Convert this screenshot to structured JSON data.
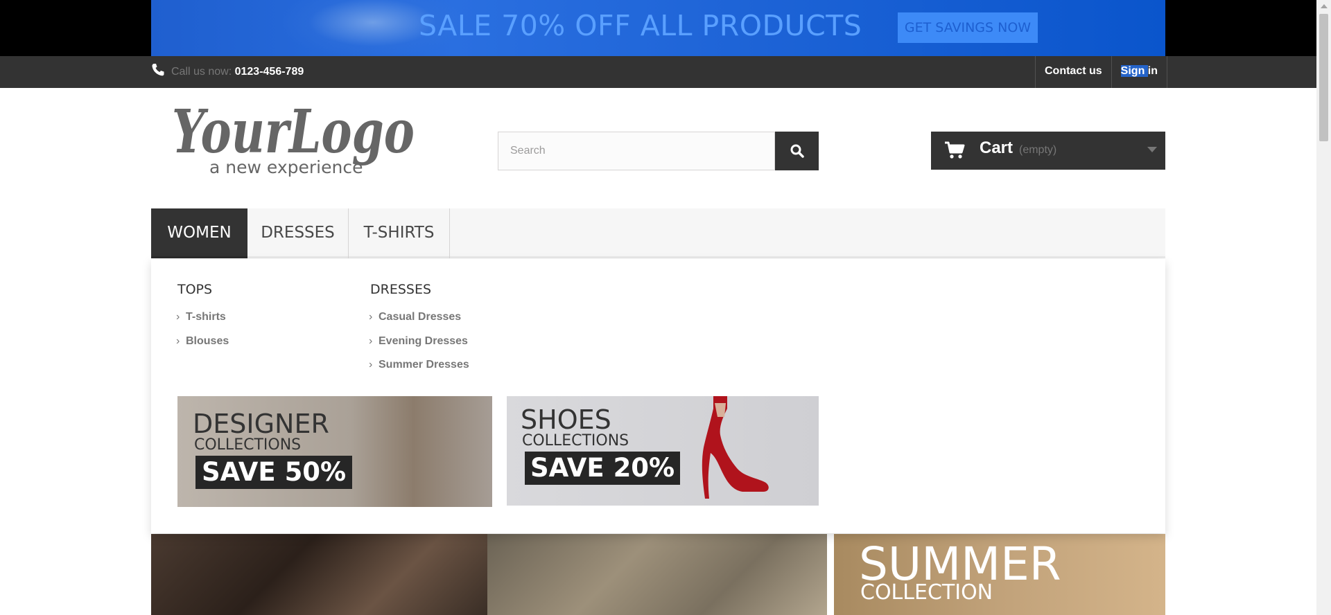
{
  "banner": {
    "text": "SALE 70% OFF ALL PRODUCTS",
    "cta": "GET SAVINGS NOW"
  },
  "topbar": {
    "call_label": "Call us now:",
    "phone": "0123-456-789",
    "contact": "Contact us",
    "signin_highlight": "Sign ",
    "signin_rest": "in"
  },
  "header": {
    "logo_text": "YourLogo",
    "logo_tagline": "a new experience",
    "search_placeholder": "Search",
    "cart_label": "Cart",
    "cart_status": "(empty)"
  },
  "menu": {
    "items": [
      {
        "label": "WOMEN",
        "active": true
      },
      {
        "label": "DRESSES",
        "active": false
      },
      {
        "label": "T-SHIRTS",
        "active": false
      }
    ]
  },
  "dropdown": {
    "columns": [
      {
        "title": "TOPS",
        "links": [
          "T-shirts",
          "Blouses"
        ]
      },
      {
        "title": "DRESSES",
        "links": [
          "Casual Dresses",
          "Evening Dresses",
          "Summer Dresses"
        ]
      }
    ],
    "promos": [
      {
        "title": "DESIGNER",
        "subtitle": "COLLECTIONS",
        "save": "SAVE 50%"
      },
      {
        "title": "SHOES",
        "subtitle": "COLLECTIONS",
        "save": "SAVE 20%"
      }
    ]
  },
  "slider": {
    "summer_title": "SUMMER",
    "summer_sub": "COLLECTION"
  },
  "colors": {
    "banner_blue": "#1d63d6",
    "dark": "#333333",
    "signin_highlight": "#2463c9"
  }
}
